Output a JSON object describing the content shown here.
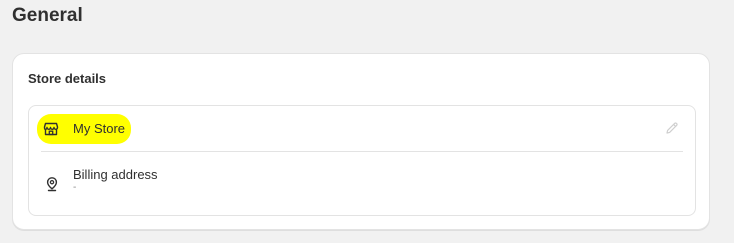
{
  "page": {
    "title": "General"
  },
  "store_details": {
    "title": "Store details",
    "store_name": "My Store",
    "billing_label": "Billing address",
    "billing_value": "-"
  },
  "icons": {
    "store": "store-icon",
    "location": "location-pin-icon",
    "edit": "pencil-icon"
  },
  "colors": {
    "highlight": "#ffff00",
    "background": "#f1f1f1",
    "card": "#ffffff"
  }
}
